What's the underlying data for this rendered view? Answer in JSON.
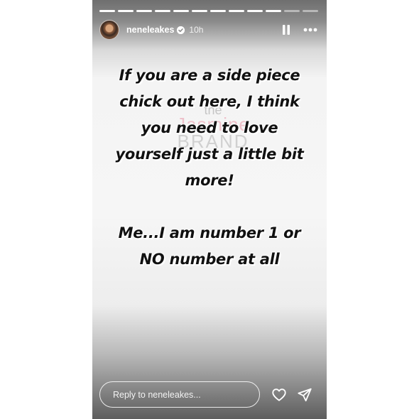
{
  "story": {
    "username": "neneleakes",
    "time_ago": "10h",
    "progress": {
      "total_segments": 12,
      "completed_segments": 10
    },
    "watermark": {
      "line1": "the",
      "line2": "Jasmine",
      "line3": "BRAND"
    },
    "text_paragraph_1": [
      "If you are a side piece",
      "chick out here, I think",
      "you need to love",
      "yourself just a little bit",
      "more!"
    ],
    "text_paragraph_2": [
      "Me...I am number 1 or",
      "NO number at all"
    ],
    "reply_placeholder": "Reply to neneleakes..."
  },
  "icons": {
    "verified": "verified-badge-icon",
    "pause": "pause-icon",
    "more": "more-options-icon",
    "like": "heart-icon",
    "send": "send-icon"
  },
  "colors": {
    "story_top": "#6f6f6f",
    "story_mid": "#f6f6f6",
    "story_bottom": "#5e5e5e",
    "text": "#111111",
    "ui_white": "#ffffff"
  }
}
